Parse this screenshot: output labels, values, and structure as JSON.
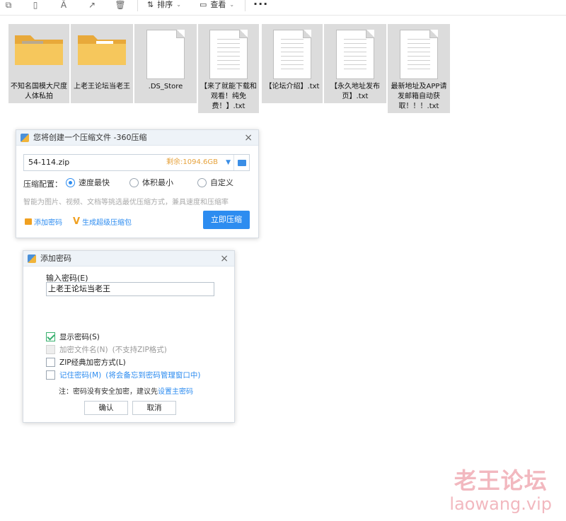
{
  "toolbar": {
    "sort_label": "排序",
    "view_label": "查看",
    "more_label": "···"
  },
  "files": [
    {
      "name": "不知名国模大尺度人体私拍",
      "type": "folder-photo"
    },
    {
      "name": "上老王论坛当老王",
      "type": "folder"
    },
    {
      "name": ".DS_Store",
      "type": "blank"
    },
    {
      "name": "【来了就能下载和观看！纯免费！】.txt",
      "type": "text"
    },
    {
      "name": "【论坛介绍】.txt",
      "type": "text"
    },
    {
      "name": "【永久地址发布页】.txt",
      "type": "text"
    },
    {
      "name": "最新地址及APP请发邮箱自动获取！！！.txt",
      "type": "text"
    }
  ],
  "compress_dialog": {
    "title": "您将创建一个压缩文件 -360压缩",
    "close": "×",
    "path_value": "54-114.zip",
    "space_text": "剩余:1094.6GB",
    "config_label": "压缩配置：",
    "options": [
      "速度最快",
      "体积最小",
      "自定义"
    ],
    "selected_option": "速度最快",
    "hint": "智能为图片、视频、文档等挑选最优压缩方式，兼具速度和压缩率",
    "add_password": "添加密码",
    "super_pack": "生成超级压缩包",
    "compress_now": "立即压缩",
    "accent": "#2d8cf0"
  },
  "password_dialog": {
    "title": "添加密码",
    "close": "×",
    "input_label": "输入密码(E)",
    "password_value": "上老王论坛当老王",
    "show_password": {
      "label": "显示密码(S)",
      "checked": true
    },
    "encrypt_names": {
      "label": "加密文件名(N)",
      "suffix": "(不支持ZIP格式)",
      "enabled": false
    },
    "zip_classic": {
      "label": "ZIP经典加密方式(L)",
      "checked": false
    },
    "remember": {
      "label": "记住密码(M)",
      "suffix": "(将会备忘到密码管理窗口中)",
      "checked": false
    },
    "note_prefix": "注：密码没有安全加密，建议先",
    "note_link": "设置主密码",
    "ok": "确认",
    "cancel": "取消"
  },
  "watermark": {
    "line1": "老王论坛",
    "line2": "laowang.vip"
  }
}
